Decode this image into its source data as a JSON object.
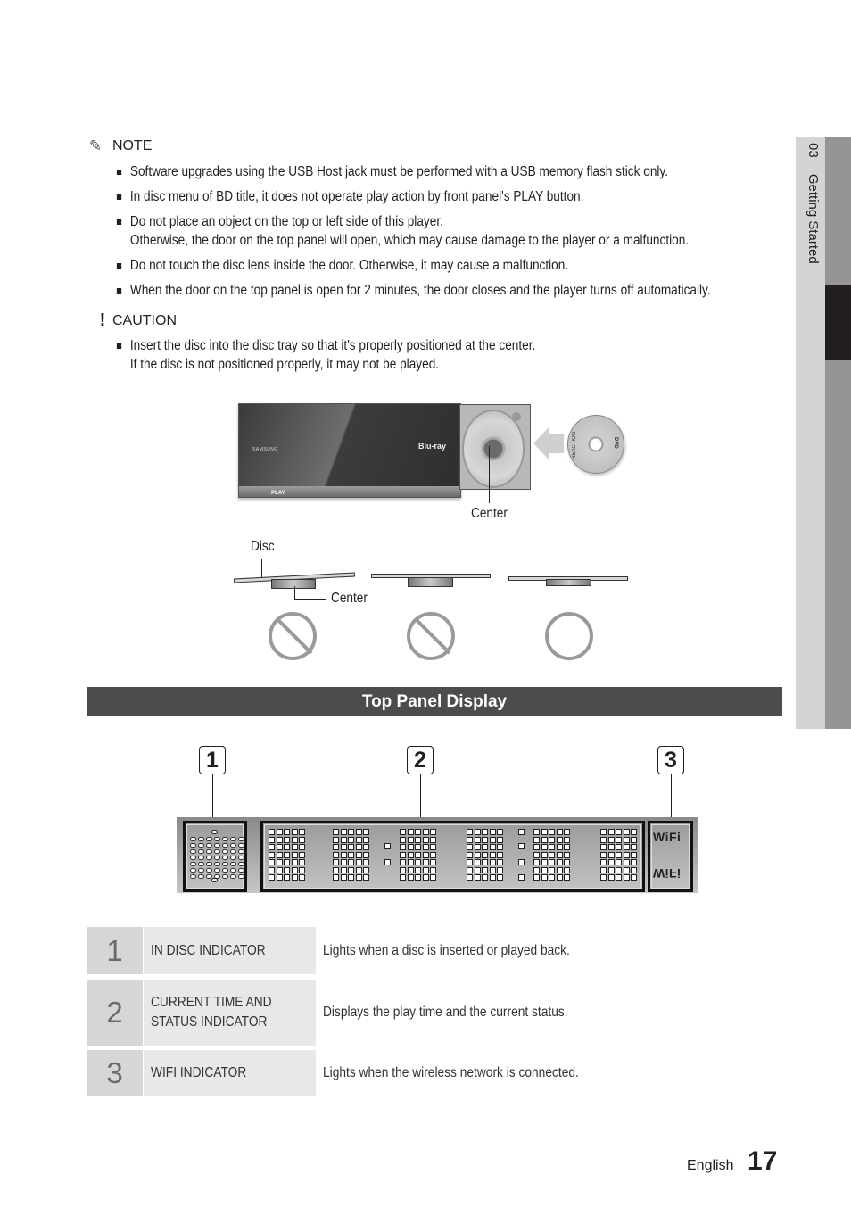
{
  "side_tab": {
    "chapter_number": "03",
    "chapter_title": "Getting Started"
  },
  "note": {
    "icon": "pencil-note-icon",
    "heading": "NOTE",
    "items": [
      {
        "line1": "Software upgrades using the USB Host jack must be performed with a USB memory flash stick only.",
        "line2": ""
      },
      {
        "line1": "In disc menu of BD title, it does not operate play action by front panel's PLAY button.",
        "line2": ""
      },
      {
        "line1": "Do not place an object on the top or left side of this player.",
        "line2": "Otherwise, the door on the top panel will open, which may cause damage to the player or a malfunction."
      },
      {
        "line1": "Do not touch the disc lens inside the door. Otherwise, it may cause a malfunction.",
        "line2": ""
      },
      {
        "line1": "When the door on the top panel is open for 2 minutes, the door closes and the player turns off automatically.",
        "line2": ""
      }
    ]
  },
  "caution": {
    "icon": "exclamation-icon",
    "heading": "CAUTION",
    "items": [
      {
        "line1": "Insert the disc into the disc tray so that it's properly positioned at the center.",
        "line2": "If the disc is not positioned properly, it may not be played."
      }
    ]
  },
  "figure_player": {
    "brand": "SAMSUNG",
    "play_label": "PLAY",
    "bluray_logo": "Blu-ray",
    "disc_label": "REACTION",
    "disc_format": "DVD",
    "center_label": "Center"
  },
  "figure_positions": {
    "disc_label": "Disc",
    "center_label": "Center",
    "states": [
      {
        "name": "tilted",
        "allowed": false
      },
      {
        "name": "raised",
        "allowed": false
      },
      {
        "name": "seated",
        "allowed": true
      }
    ]
  },
  "section": {
    "title": "Top Panel Display"
  },
  "display": {
    "callouts": [
      "1",
      "2",
      "3"
    ],
    "wifi_text": "WiFi",
    "wifi_mirror": "WiFi"
  },
  "table": {
    "rows": [
      {
        "num": "1",
        "name_line1": "IN DISC INDICATOR",
        "name_line2": "",
        "description": "Lights when a disc is inserted or played back."
      },
      {
        "num": "2",
        "name_line1": "CURRENT TIME AND",
        "name_line2": "STATUS INDICATOR",
        "description": "Displays the play time and the current status."
      },
      {
        "num": "3",
        "name_line1": "WIFI INDICATOR",
        "name_line2": "",
        "description": "Lights when the wireless network is connected."
      }
    ]
  },
  "footer": {
    "language": "English",
    "page_number": "17"
  }
}
